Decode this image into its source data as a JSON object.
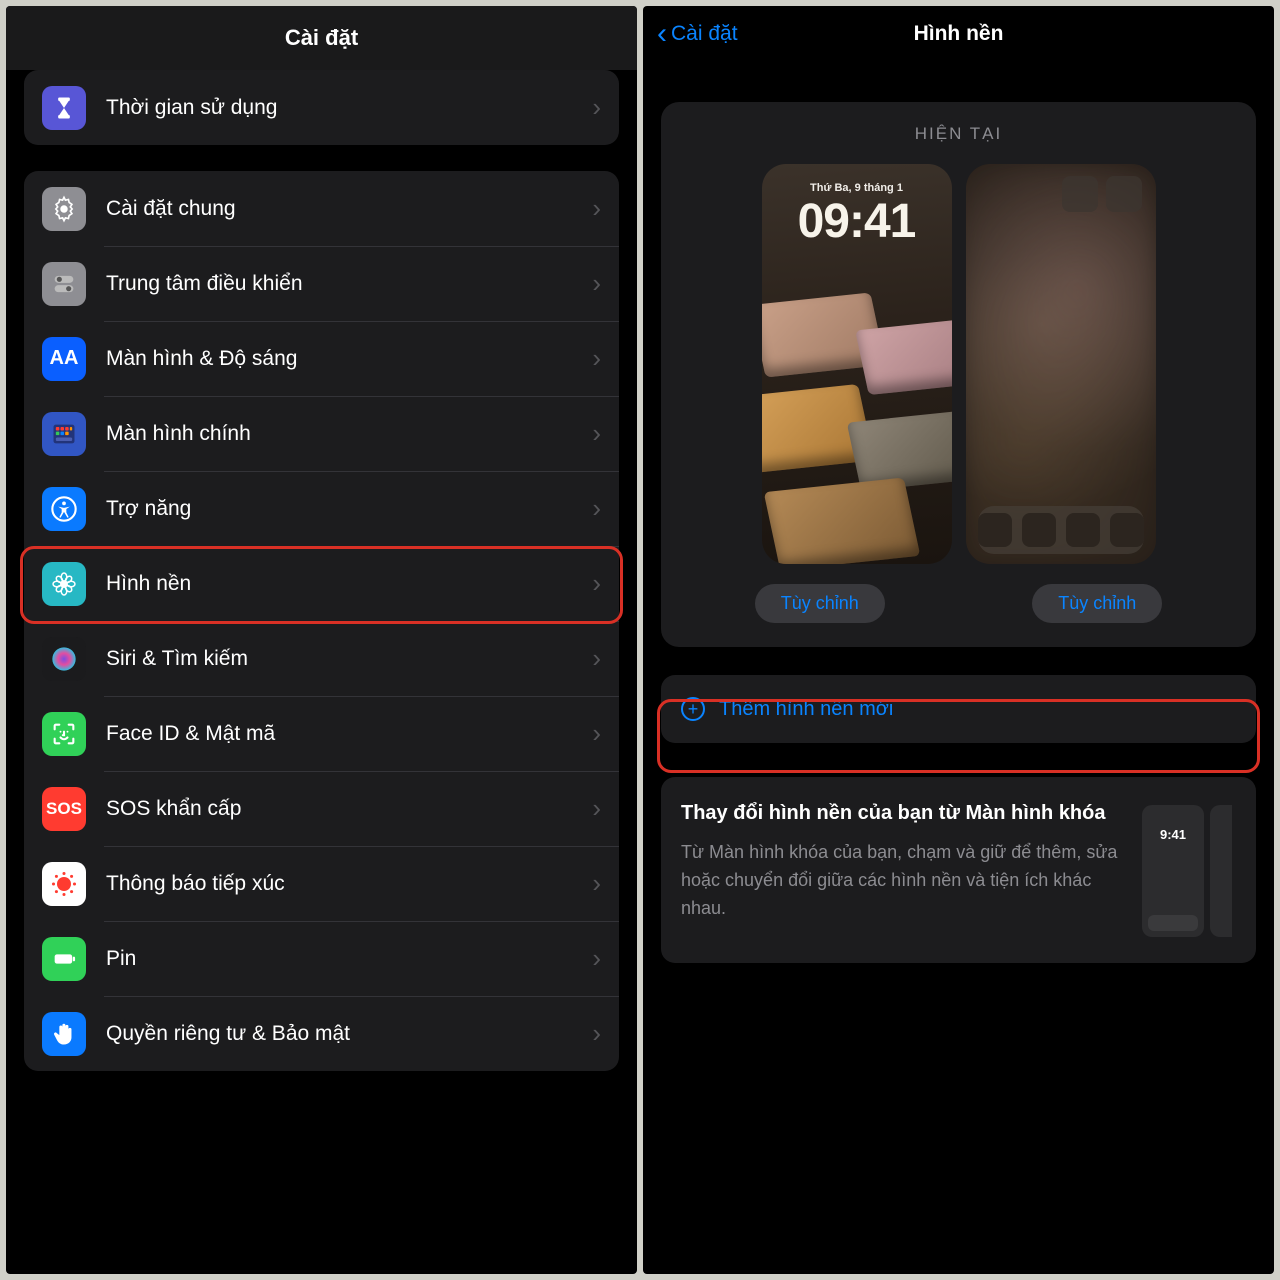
{
  "left": {
    "title": "Cài đặt",
    "screenTime": "Thời gian sử dụng",
    "items": [
      {
        "label": "Cài đặt chung",
        "icon": "gear",
        "bg": "#8e8e93"
      },
      {
        "label": "Trung tâm điều khiển",
        "icon": "switches",
        "bg": "#8e8e93"
      },
      {
        "label": "Màn hình & Độ sáng",
        "icon": "aa",
        "bg": "#0a5fff"
      },
      {
        "label": "Màn hình chính",
        "icon": "grid",
        "bg": "#3156c4"
      },
      {
        "label": "Trợ năng",
        "icon": "access",
        "bg": "#0a7aff"
      },
      {
        "label": "Hình nền",
        "icon": "flower",
        "bg": "#27b8c4"
      },
      {
        "label": "Siri & Tìm kiếm",
        "icon": "siri",
        "bg": "#1b1b1d"
      },
      {
        "label": "Face ID & Mật mã",
        "icon": "faceid",
        "bg": "#30d158"
      },
      {
        "label": "SOS khẩn cấp",
        "icon": "sos",
        "bg": "#ff3b30"
      },
      {
        "label": "Thông báo tiếp xúc",
        "icon": "exposure",
        "bg": "#ffffff"
      },
      {
        "label": "Pin",
        "icon": "battery",
        "bg": "#30d158"
      },
      {
        "label": "Quyền riêng tư & Bảo mật",
        "icon": "hand",
        "bg": "#0a7aff"
      }
    ]
  },
  "right": {
    "back": "Cài đặt",
    "title": "Hình nền",
    "current": "HIỆN TẠI",
    "lockDate": "Thứ Ba, 9 tháng 1",
    "lockTime": "09:41",
    "customize": "Tùy chỉnh",
    "addNew": "Thêm hình nền mới",
    "info": {
      "title": "Thay đổi hình nền của bạn từ Màn hình khóa",
      "body": "Từ Màn hình khóa của bạn, chạm và giữ để thêm, sửa hoặc chuyển đổi giữa các hình nền và tiện ích khác nhau.",
      "miniTime": "9:41"
    }
  }
}
